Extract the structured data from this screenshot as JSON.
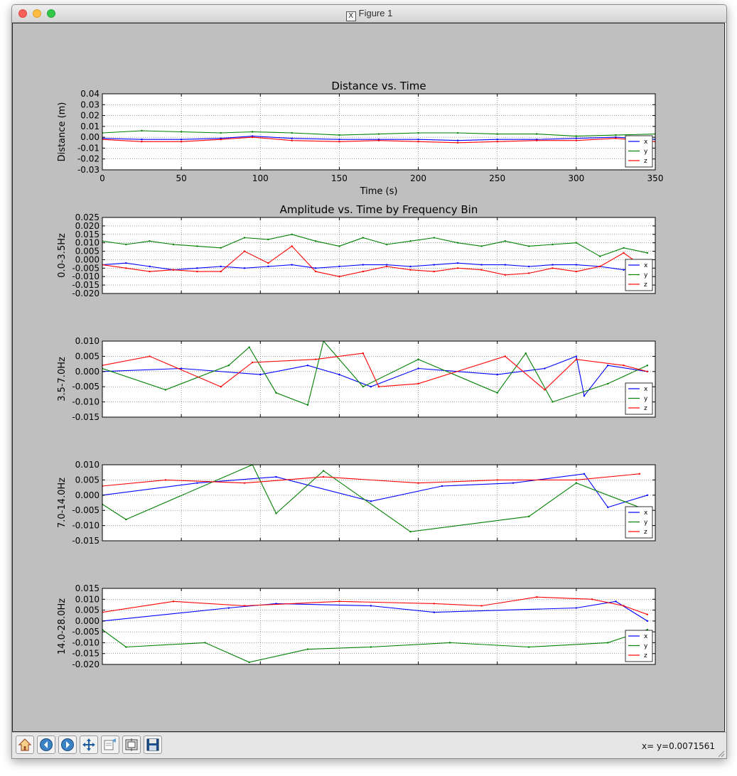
{
  "window": {
    "title": "Figure 1"
  },
  "toolbar": {
    "buttons": [
      {
        "name": "home-button",
        "icon": "home-icon"
      },
      {
        "name": "back-button",
        "icon": "back-arrow-icon"
      },
      {
        "name": "forward-button",
        "icon": "forward-arrow-icon"
      },
      {
        "name": "pan-button",
        "icon": "pan-arrows-icon"
      },
      {
        "name": "zoom-button",
        "icon": "zoom-rect-icon"
      },
      {
        "name": "subplots-button",
        "icon": "subplots-icon"
      },
      {
        "name": "save-button",
        "icon": "save-disk-icon"
      }
    ],
    "coordinates": "x= y=0.0071561"
  },
  "colors": {
    "x": "#0000ff",
    "y": "#008000",
    "z": "#ff0000",
    "figure_bg": "#bfbfbf"
  },
  "chart_data": [
    {
      "type": "line",
      "title": "Distance vs. Time",
      "xlabel": "Time (s)",
      "ylabel": "Distance (m)",
      "xlim": [
        0,
        350
      ],
      "ylim": [
        -0.03,
        0.04
      ],
      "xticks": [
        0,
        50,
        100,
        150,
        200,
        250,
        300,
        350
      ],
      "yticks": [
        -0.03,
        -0.02,
        -0.01,
        0.0,
        0.01,
        0.02,
        0.03,
        0.04
      ],
      "show_xticklabels": true,
      "grid": true,
      "legend": "lower-right",
      "series": [
        {
          "name": "x",
          "x": [
            0,
            25,
            50,
            75,
            95,
            120,
            150,
            175,
            200,
            225,
            250,
            275,
            300,
            325,
            350
          ],
          "y": [
            -0.001,
            -0.002,
            -0.002,
            -0.001,
            0.001,
            -0.001,
            -0.002,
            -0.002,
            -0.002,
            -0.003,
            -0.002,
            -0.002,
            -0.001,
            0.0,
            -0.002
          ]
        },
        {
          "name": "y",
          "x": [
            0,
            25,
            50,
            75,
            95,
            120,
            150,
            175,
            200,
            225,
            250,
            275,
            300,
            325,
            350
          ],
          "y": [
            0.004,
            0.006,
            0.005,
            0.004,
            0.005,
            0.004,
            0.002,
            0.003,
            0.004,
            0.004,
            0.003,
            0.003,
            0.001,
            0.002,
            0.003
          ]
        },
        {
          "name": "z",
          "x": [
            0,
            25,
            50,
            75,
            95,
            120,
            150,
            175,
            200,
            225,
            250,
            275,
            300,
            325,
            350
          ],
          "y": [
            -0.002,
            -0.004,
            -0.004,
            -0.002,
            0.0,
            -0.003,
            -0.004,
            -0.003,
            -0.004,
            -0.005,
            -0.004,
            -0.003,
            -0.003,
            -0.001,
            -0.004
          ]
        }
      ]
    },
    {
      "type": "line",
      "title": "Amplitude vs. Time by Frequency Bin",
      "xlabel": "",
      "ylabel": "0.0-3.5Hz",
      "xlim": [
        0,
        350
      ],
      "ylim": [
        -0.02,
        0.025
      ],
      "xticks": [
        0,
        50,
        100,
        150,
        200,
        250,
        300,
        350
      ],
      "yticks": [
        -0.02,
        -0.015,
        -0.01,
        -0.005,
        0.0,
        0.005,
        0.01,
        0.015,
        0.02,
        0.025
      ],
      "show_xticklabels": false,
      "grid": true,
      "legend": "lower-right",
      "series": [
        {
          "name": "x",
          "x": [
            0,
            15,
            30,
            45,
            60,
            75,
            90,
            105,
            120,
            135,
            150,
            165,
            180,
            195,
            210,
            225,
            240,
            255,
            270,
            285,
            300,
            315,
            330,
            345
          ],
          "y": [
            -0.003,
            -0.002,
            -0.004,
            -0.006,
            -0.005,
            -0.004,
            -0.005,
            -0.004,
            -0.003,
            -0.005,
            -0.004,
            -0.003,
            -0.003,
            -0.004,
            -0.003,
            -0.002,
            -0.003,
            -0.003,
            -0.004,
            -0.003,
            -0.003,
            -0.004,
            -0.006,
            -0.004
          ]
        },
        {
          "name": "y",
          "x": [
            0,
            15,
            30,
            45,
            60,
            75,
            90,
            105,
            120,
            135,
            150,
            165,
            180,
            195,
            210,
            225,
            240,
            255,
            270,
            285,
            300,
            315,
            330,
            345
          ],
          "y": [
            0.011,
            0.009,
            0.011,
            0.009,
            0.008,
            0.007,
            0.013,
            0.012,
            0.015,
            0.011,
            0.008,
            0.013,
            0.009,
            0.011,
            0.013,
            0.01,
            0.008,
            0.011,
            0.008,
            0.009,
            0.01,
            0.002,
            0.007,
            0.004
          ]
        },
        {
          "name": "z",
          "x": [
            0,
            15,
            30,
            45,
            60,
            75,
            90,
            105,
            120,
            135,
            150,
            165,
            180,
            195,
            210,
            225,
            240,
            255,
            270,
            285,
            300,
            315,
            330,
            345
          ],
          "y": [
            -0.003,
            -0.005,
            -0.007,
            -0.006,
            -0.007,
            -0.007,
            0.005,
            -0.002,
            0.008,
            -0.007,
            -0.01,
            -0.007,
            -0.004,
            -0.006,
            -0.007,
            -0.005,
            -0.006,
            -0.009,
            -0.008,
            -0.005,
            -0.007,
            -0.004,
            0.004,
            -0.006
          ]
        }
      ]
    },
    {
      "type": "line",
      "title": "",
      "xlabel": "",
      "ylabel": "3.5-7.0Hz",
      "xlim": [
        0,
        350
      ],
      "ylim": [
        -0.015,
        0.01
      ],
      "xticks": [
        0,
        50,
        100,
        150,
        200,
        250,
        300,
        350
      ],
      "yticks": [
        -0.015,
        -0.01,
        -0.005,
        0.0,
        0.005,
        0.01
      ],
      "show_xticklabels": false,
      "grid": true,
      "legend": "lower-right",
      "series": [
        {
          "name": "x",
          "x": [
            0,
            50,
            100,
            130,
            150,
            170,
            200,
            250,
            280,
            300,
            305,
            320,
            345
          ],
          "y": [
            0.0,
            0.001,
            -0.001,
            0.002,
            -0.001,
            -0.005,
            0.001,
            -0.001,
            0.001,
            0.005,
            -0.008,
            0.002,
            0.0
          ]
        },
        {
          "name": "y",
          "x": [
            0,
            40,
            80,
            93,
            110,
            130,
            140,
            165,
            200,
            250,
            268,
            285,
            320,
            345
          ],
          "y": [
            0.001,
            -0.006,
            0.002,
            0.008,
            -0.007,
            -0.011,
            0.01,
            -0.005,
            0.004,
            -0.007,
            0.006,
            -0.01,
            -0.004,
            0.002
          ]
        },
        {
          "name": "z",
          "x": [
            0,
            30,
            75,
            95,
            135,
            165,
            175,
            200,
            255,
            280,
            300,
            330,
            345
          ],
          "y": [
            0.002,
            0.005,
            -0.005,
            0.003,
            0.004,
            0.006,
            -0.005,
            -0.004,
            0.005,
            -0.006,
            0.004,
            0.002,
            0.0
          ]
        }
      ]
    },
    {
      "type": "line",
      "title": "",
      "xlabel": "",
      "ylabel": "7.0-14.0Hz",
      "xlim": [
        0,
        350
      ],
      "ylim": [
        -0.015,
        0.01
      ],
      "xticks": [
        0,
        50,
        100,
        150,
        200,
        250,
        300,
        350
      ],
      "yticks": [
        -0.015,
        -0.01,
        -0.005,
        0.0,
        0.005,
        0.01
      ],
      "show_xticklabels": false,
      "grid": true,
      "legend": "lower-right",
      "series": [
        {
          "name": "x",
          "x": [
            0,
            60,
            110,
            170,
            215,
            260,
            305,
            320,
            345
          ],
          "y": [
            0.0,
            0.004,
            0.006,
            -0.002,
            0.003,
            0.004,
            0.007,
            -0.004,
            0.0
          ]
        },
        {
          "name": "y",
          "x": [
            0,
            15,
            95,
            110,
            140,
            195,
            270,
            300,
            340
          ],
          "y": [
            -0.003,
            -0.008,
            0.01,
            -0.006,
            0.008,
            -0.012,
            -0.007,
            0.004,
            -0.004
          ]
        },
        {
          "name": "z",
          "x": [
            0,
            40,
            90,
            140,
            200,
            250,
            300,
            340
          ],
          "y": [
            0.003,
            0.005,
            0.004,
            0.006,
            0.004,
            0.005,
            0.005,
            0.007
          ]
        }
      ]
    },
    {
      "type": "line",
      "title": "",
      "xlabel": "",
      "ylabel": "14.0-28.0Hz",
      "xlim": [
        0,
        350
      ],
      "ylim": [
        -0.02,
        0.015
      ],
      "xticks": [
        0,
        50,
        100,
        150,
        200,
        250,
        300,
        350
      ],
      "yticks": [
        -0.02,
        -0.015,
        -0.01,
        -0.005,
        0.0,
        0.005,
        0.01,
        0.015
      ],
      "show_xticklabels": false,
      "grid": true,
      "legend": "lower-right",
      "series": [
        {
          "name": "x",
          "x": [
            0,
            80,
            110,
            170,
            210,
            300,
            325,
            345
          ],
          "y": [
            0.0,
            0.006,
            0.008,
            0.007,
            0.004,
            0.006,
            0.009,
            0.0
          ]
        },
        {
          "name": "y",
          "x": [
            0,
            15,
            65,
            93,
            130,
            170,
            220,
            270,
            320,
            345
          ],
          "y": [
            -0.004,
            -0.012,
            -0.01,
            -0.019,
            -0.013,
            -0.012,
            -0.01,
            -0.012,
            -0.01,
            -0.004
          ]
        },
        {
          "name": "z",
          "x": [
            0,
            45,
            90,
            150,
            210,
            240,
            275,
            310,
            330,
            345
          ],
          "y": [
            0.004,
            0.009,
            0.007,
            0.009,
            0.008,
            0.007,
            0.011,
            0.01,
            0.007,
            0.003
          ]
        }
      ]
    }
  ]
}
